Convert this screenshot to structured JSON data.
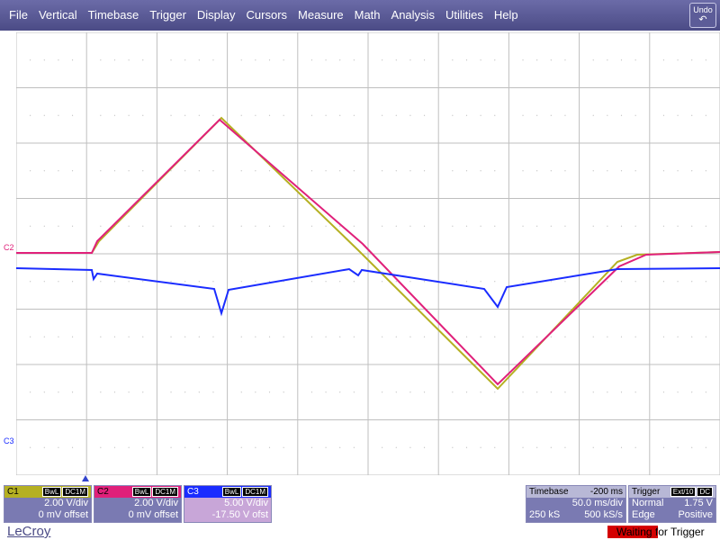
{
  "menu": {
    "items": [
      "File",
      "Vertical",
      "Timebase",
      "Trigger",
      "Display",
      "Cursors",
      "Measure",
      "Math",
      "Analysis",
      "Utilities",
      "Help"
    ],
    "undo_label": "Undo"
  },
  "markers": {
    "c2": "C2",
    "c3": "C3"
  },
  "colors": {
    "c1": "#b5b022",
    "c2": "#e0207a",
    "c3": "#1a2cff",
    "grid": "#bfbfbf",
    "menubar": "#5a5a96"
  },
  "channels": {
    "c1": {
      "name": "C1",
      "tag1": "BwL",
      "tag2": "DC1M",
      "vdiv": "2.00 V/div",
      "offset": "0 mV offset"
    },
    "c2": {
      "name": "C2",
      "tag1": "BwL",
      "tag2": "DC1M",
      "vdiv": "2.00 V/div",
      "offset": "0 mV offset"
    },
    "c3": {
      "name": "C3",
      "tag1": "BwL",
      "tag2": "DC1M",
      "vdiv": "5.00 V/div",
      "offset": "-17.50 V ofst"
    }
  },
  "timebase": {
    "label": "Timebase",
    "delay": "-200 ms",
    "tdiv": "50.0 ms/div",
    "samples": "250 kS",
    "rate": "500 kS/s"
  },
  "trigger": {
    "label": "Trigger",
    "tag1": "Ext/10",
    "tag2": "DC",
    "mode": "Normal",
    "level": "1.75 V",
    "type": "Edge",
    "slope": "Positive"
  },
  "brand": "LeCroy",
  "status": "Waiting for Trigger"
}
